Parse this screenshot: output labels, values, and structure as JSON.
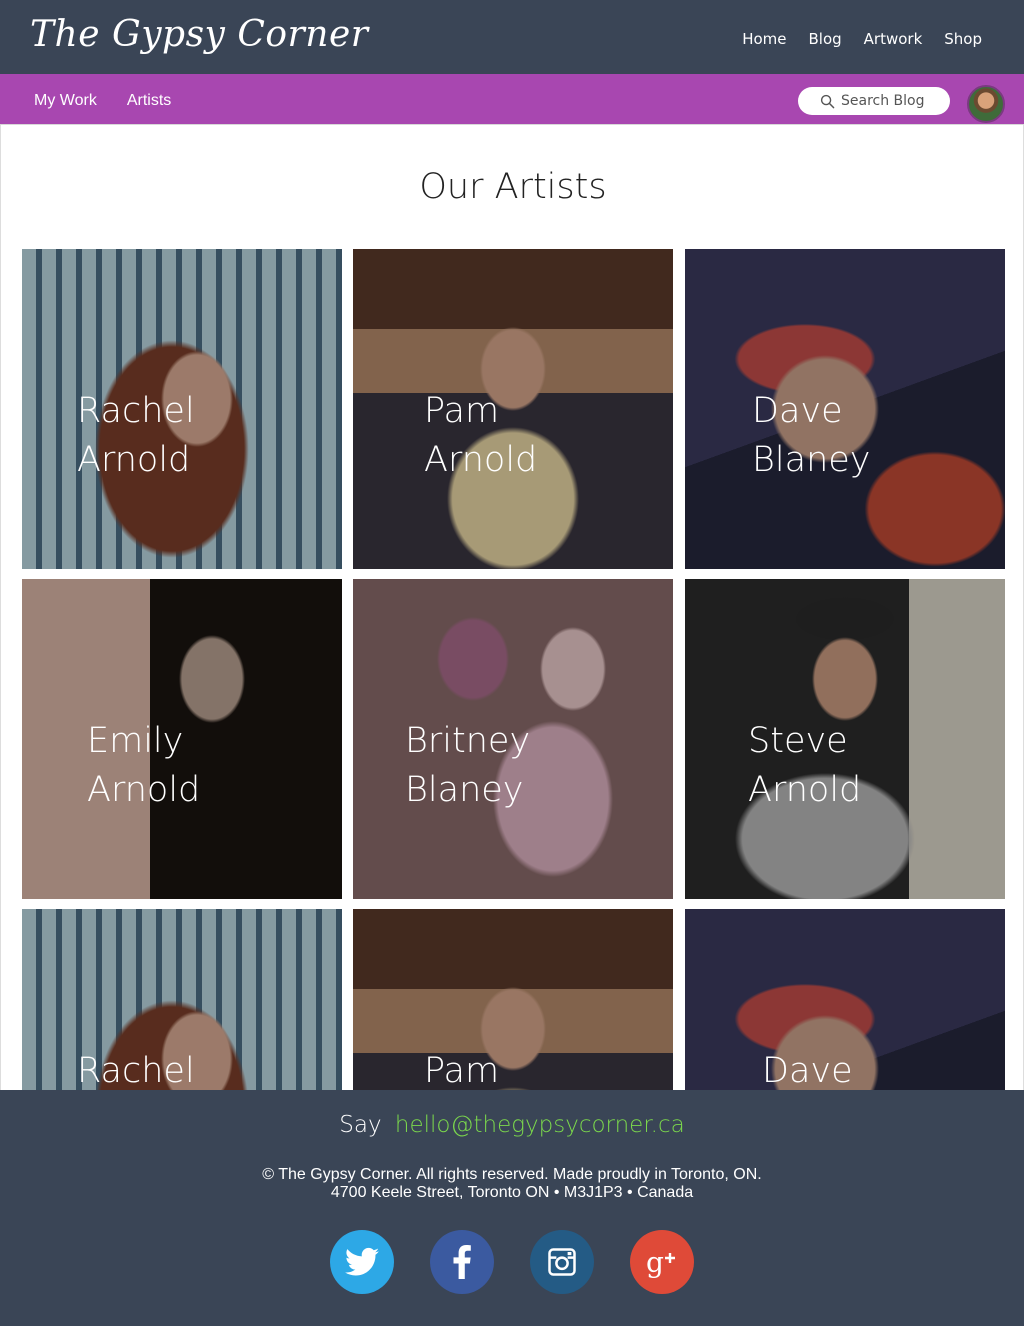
{
  "header": {
    "logo": "The Gypsy Corner",
    "nav": [
      "Home",
      "Blog",
      "Artwork",
      "Shop"
    ]
  },
  "subnav": {
    "items": [
      "My Work",
      "Artists"
    ],
    "search_placeholder": "Search Blog"
  },
  "main": {
    "title": "Our Artists",
    "artists": [
      {
        "name": "Rachel\nArnold"
      },
      {
        "name": "Pam\nArnold"
      },
      {
        "name": "Dave\nBlaney"
      },
      {
        "name": "Emily\nArnold"
      },
      {
        "name": "Britney\nBlaney"
      },
      {
        "name": "Steve\nArnold"
      },
      {
        "name": "Rachel"
      },
      {
        "name": "Pam"
      },
      {
        "name": "Dave"
      }
    ]
  },
  "footer": {
    "say": "Say",
    "email": "hello@thegypsycorner.ca",
    "copyright": "© The Gypsy Corner. All rights reserved. Made proudly in Toronto, ON.",
    "address": "4700 Keele Street, Toronto ON • M3J1P3 • Canada",
    "social": [
      "twitter-icon",
      "facebook-icon",
      "instagram-icon",
      "google-plus-icon"
    ]
  },
  "colors": {
    "header_bg": "#3a4556",
    "subnav_bg": "#a847b0",
    "email_accent": "#7bd84c"
  }
}
